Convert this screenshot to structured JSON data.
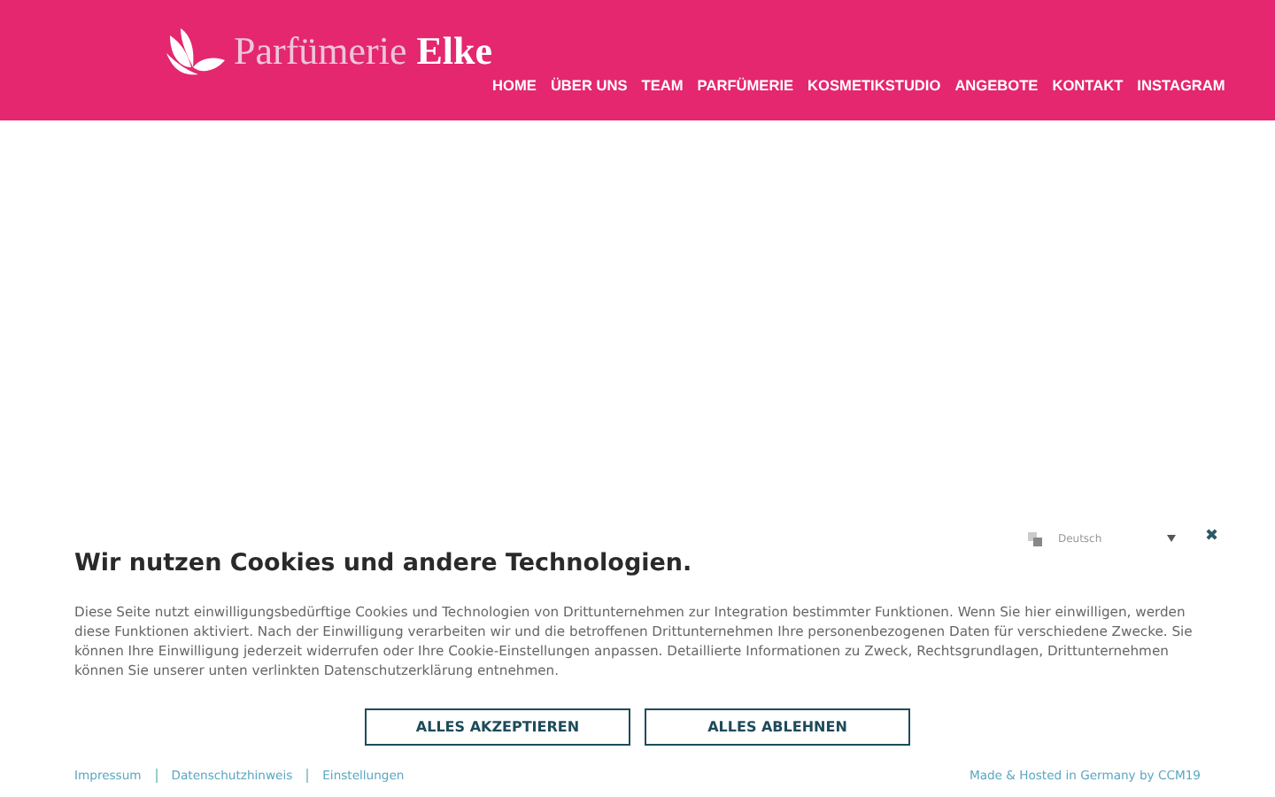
{
  "header": {
    "logo": {
      "part_1": "Parfümerie",
      "part_2": "Elke"
    },
    "nav": [
      {
        "label": "HOME"
      },
      {
        "label": "ÜBER UNS"
      },
      {
        "label": "TEAM"
      },
      {
        "label": "PARFÜMERIE"
      },
      {
        "label": "KOSMETIKSTUDIO"
      },
      {
        "label": "ANGEBOTE"
      },
      {
        "label": "KONTAKT"
      },
      {
        "label": "INSTAGRAM"
      }
    ]
  },
  "cookie_banner": {
    "language": "Deutsch",
    "close": "✖",
    "title": "Wir nutzen Cookies und andere Technologien.",
    "text": "Diese Seite nutzt einwilligungsbedürftige Cookies und Technologien von Drittunternehmen zur Integration bestimmter Funktionen. Wenn Sie hier einwilligen, werden diese Funktionen aktiviert. Nach der Einwilligung verarbeiten wir und die betroffenen Drittunternehmen Ihre personenbezogenen Daten für verschiedene Zwecke. Sie können Ihre Einwilligung jederzeit widerrufen oder Ihre Cookie-Einstellungen anpassen. Detaillierte Informationen zu Zweck, Rechtsgrundlagen, Drittunternehmen können Sie unserer unten verlinkten Datenschutzerklärung entnehmen.",
    "buttons": [
      "ALLES AKZEPTIEREN",
      "ALLES ABLEHNEN"
    ],
    "links": [
      "Impressum",
      "Datenschutzhinweis",
      "Einstellungen"
    ],
    "credit": "Made & Hosted in Germany by CCM19"
  }
}
